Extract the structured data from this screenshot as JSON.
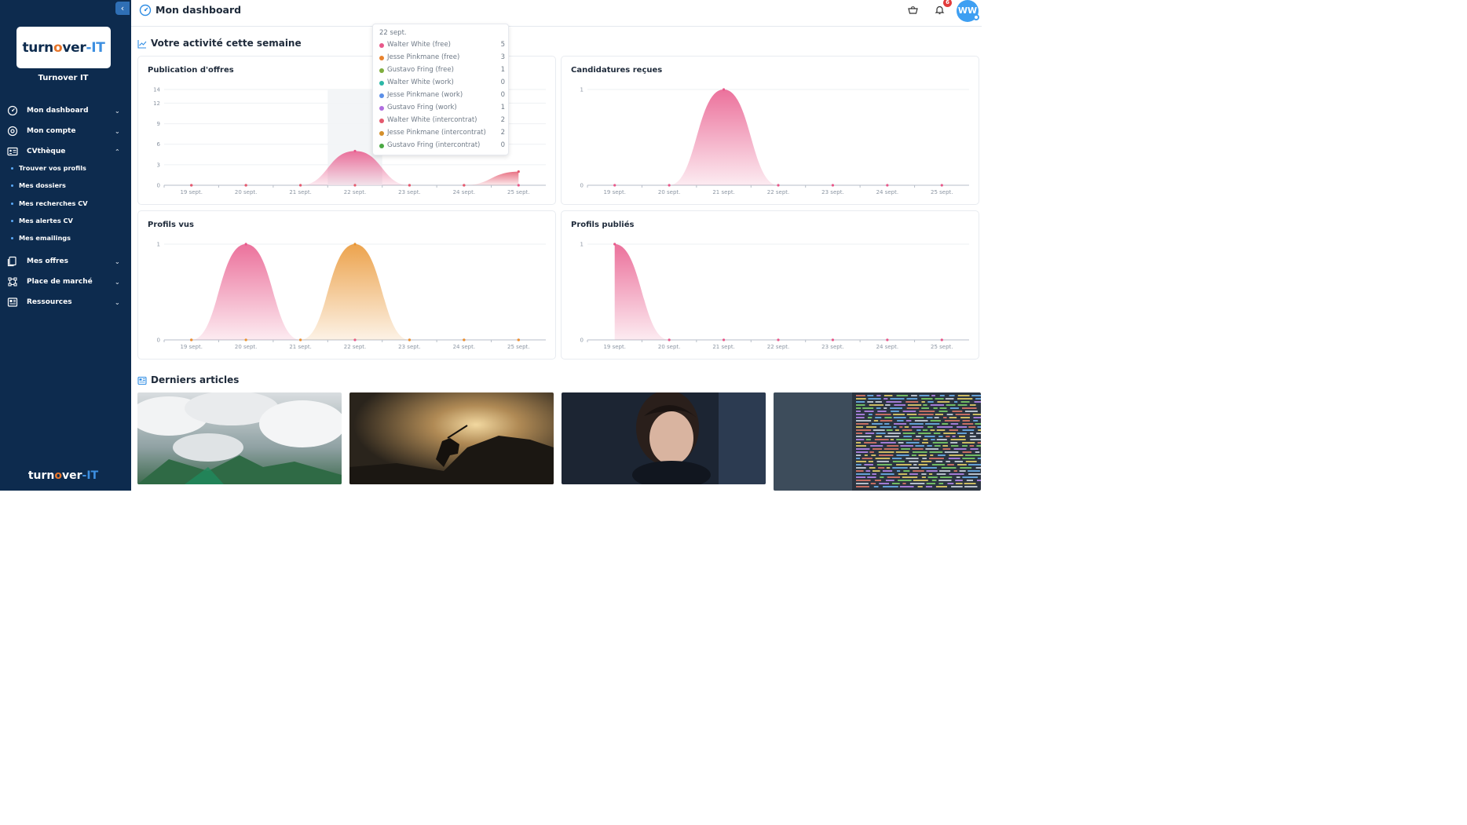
{
  "sidebar": {
    "collapse_icon": "chevron-left-icon",
    "logo": {
      "part1": "turn",
      "part2": "o",
      "part3": "ver",
      "part4": "-IT"
    },
    "company_name": "Turnover IT",
    "nav": [
      {
        "label": "Mon dashboard",
        "icon": "gauge-icon",
        "expanded": false
      },
      {
        "label": "Mon compte",
        "icon": "settings-icon",
        "expanded": false
      },
      {
        "label": "CVthèque",
        "icon": "id-card-icon",
        "expanded": true,
        "children": [
          "Trouver vos profils",
          "Mes dossiers",
          "Mes recherches CV",
          "Mes alertes CV",
          "Mes emailings"
        ]
      },
      {
        "label": "Mes offres",
        "icon": "copy-icon",
        "expanded": false
      },
      {
        "label": "Place de marché",
        "icon": "market-icon",
        "expanded": false
      },
      {
        "label": "Ressources",
        "icon": "newspaper-icon",
        "expanded": false
      }
    ],
    "bottom_logo": {
      "part1": "turn",
      "part2": "o",
      "part3": "ver",
      "part4": "-IT"
    }
  },
  "topbar": {
    "title": "Mon dashboard",
    "notification_count": "6",
    "avatar_initials": "WW"
  },
  "activity_section": {
    "title": "Votre activité cette semaine"
  },
  "articles_section": {
    "title": "Derniers articles"
  },
  "tooltip": {
    "date": "22 sept.",
    "rows": [
      {
        "name": "Walter White (free)",
        "value": "5",
        "color": "#e8588a"
      },
      {
        "name": "Jesse Pinkmane (free)",
        "value": "3",
        "color": "#e9832e"
      },
      {
        "name": "Gustavo Fring (free)",
        "value": "1",
        "color": "#7fae3e"
      },
      {
        "name": "Walter White (work)",
        "value": "0",
        "color": "#2cb7a6"
      },
      {
        "name": "Jesse Pinkmane (work)",
        "value": "0",
        "color": "#5b8fe8"
      },
      {
        "name": "Gustavo Fring (work)",
        "value": "1",
        "color": "#b06ee0"
      },
      {
        "name": "Walter White (intercontrat)",
        "value": "2",
        "color": "#e45a6e"
      },
      {
        "name": "Jesse Pinkmane (intercontrat)",
        "value": "2",
        "color": "#d48f2a"
      },
      {
        "name": "Gustavo Fring (intercontrat)",
        "value": "0",
        "color": "#4aa843"
      }
    ]
  },
  "chart_data": [
    {
      "title": "Publication d'offres",
      "type": "area",
      "categories": [
        "19 sept.",
        "20 sept.",
        "21 sept.",
        "22 sept.",
        "23 sept.",
        "24 sept.",
        "25 sept."
      ],
      "ytick_labels": [
        "0",
        "3",
        "6",
        "9",
        "12",
        "14"
      ],
      "ylim": [
        0,
        14
      ],
      "series": [
        {
          "color": "#e8588a",
          "values": [
            0,
            0,
            0,
            5,
            0,
            0,
            0
          ]
        },
        {
          "color": "#e45a6e",
          "values": [
            0,
            0,
            0,
            0,
            0,
            0,
            2
          ]
        }
      ]
    },
    {
      "title": "Candidatures reçues",
      "type": "area",
      "categories": [
        "19 sept.",
        "20 sept.",
        "21 sept.",
        "22 sept.",
        "23 sept.",
        "24 sept.",
        "25 sept."
      ],
      "ytick_labels": [
        "0",
        "1"
      ],
      "ylim": [
        0,
        1
      ],
      "series": [
        {
          "color": "#e8588a",
          "values": [
            0,
            0,
            1,
            0,
            0,
            0,
            0
          ]
        }
      ]
    },
    {
      "title": "Profils vus",
      "type": "area",
      "categories": [
        "19 sept.",
        "20 sept.",
        "21 sept.",
        "22 sept.",
        "23 sept.",
        "24 sept.",
        "25 sept."
      ],
      "ytick_labels": [
        "0",
        "1"
      ],
      "ylim": [
        0,
        1
      ],
      "series": [
        {
          "color": "#e8588a",
          "values": [
            0,
            1,
            0,
            0,
            0,
            0,
            0
          ]
        },
        {
          "color": "#e9932e",
          "values": [
            0,
            0,
            0,
            1,
            0,
            0,
            0
          ]
        }
      ]
    },
    {
      "title": "Profils publiés",
      "type": "area",
      "categories": [
        "19 sept.",
        "20 sept.",
        "21 sept.",
        "22 sept.",
        "23 sept.",
        "24 sept.",
        "25 sept."
      ],
      "ytick_labels": [
        "0",
        "1"
      ],
      "ylim": [
        0,
        1
      ],
      "series": [
        {
          "color": "#e8588a",
          "values": [
            1,
            0,
            0,
            0,
            0,
            0,
            0
          ]
        }
      ]
    }
  ],
  "articles": [
    {
      "image": "clouds-over-valley"
    },
    {
      "image": "horse-rider-statue-sunset"
    },
    {
      "image": "woman-looking-at-phone"
    },
    {
      "image": "code-on-screen"
    }
  ]
}
